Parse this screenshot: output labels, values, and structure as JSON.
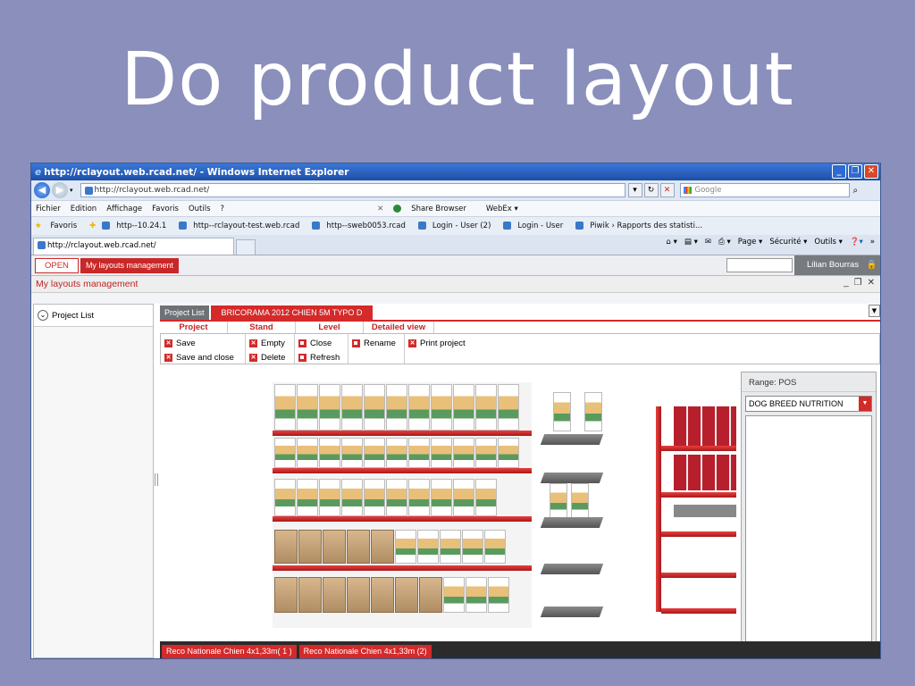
{
  "slide": {
    "title": "Do product layout"
  },
  "browser": {
    "window_title": "http://rclayout.web.rcad.net/ - Windows Internet Explorer",
    "address": "http://rclayout.web.rcad.net/",
    "search_placeholder": "Google",
    "menu": [
      "Fichier",
      "Edition",
      "Affichage",
      "Favoris",
      "Outils",
      "?"
    ],
    "menu_extra": [
      "Share Browser",
      "WebEx ▾"
    ],
    "favorites_label": "Favoris",
    "favorites": [
      "http--10.24.1",
      "http--rclayout-test.web.rcad",
      "http--sweb0053.rcad",
      "Login - User (2)",
      "Login - User",
      "Piwik › Rapports des statisti..."
    ],
    "tab_label": "http://rclayout.web.rcad.net/",
    "commands": [
      "Page ▾",
      "Sécurité ▾",
      "Outils ▾"
    ]
  },
  "app": {
    "open_button": "OPEN",
    "my_layouts_button": "My layouts management",
    "user_name": "Lilian Bourras",
    "panel_title": "My layouts management",
    "sidebar": {
      "project_list": "Project List"
    },
    "doc_tabs": [
      "Project List",
      "BRICORAMA 2012 CHIEN 5M TYPO D"
    ],
    "tool_tabs": [
      "Project",
      "Stand",
      "Level",
      "Detailed view"
    ],
    "toolbar": {
      "save": "Save",
      "save_close": "Save and close",
      "empty": "Empty",
      "delete": "Delete",
      "close": "Close",
      "refresh": "Refresh",
      "rename": "Rename",
      "print": "Print project"
    },
    "range": {
      "header": "Range: POS",
      "selected": "DOG BREED NUTRITION"
    },
    "bottom_tabs": [
      "Reco Nationale Chien 4x1,33m( 1 )",
      "Reco Nationale Chien 4x1,33m (2)"
    ]
  }
}
